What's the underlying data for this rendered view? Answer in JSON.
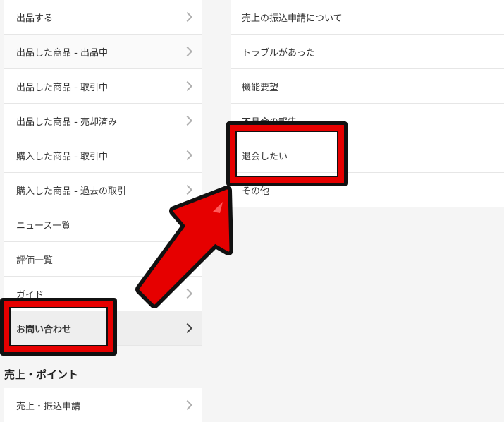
{
  "left_menu": {
    "items": [
      {
        "label": "出品する"
      },
      {
        "label": "出品した商品 - 出品中"
      },
      {
        "label": "出品した商品 - 取引中"
      },
      {
        "label": "出品した商品 - 売却済み"
      },
      {
        "label": "購入した商品 - 取引中"
      },
      {
        "label": "購入した商品 - 過去の取引"
      },
      {
        "label": "ニュース一覧"
      },
      {
        "label": "評価一覧"
      },
      {
        "label": "ガイド"
      },
      {
        "label": "お問い合わせ"
      }
    ],
    "active_label": "お問い合わせ"
  },
  "sales_section": {
    "heading": "売上・ポイント",
    "items": [
      {
        "label": "売上・振込申請"
      }
    ]
  },
  "contact_submenu": {
    "items": [
      {
        "label": "売上の振込申請について"
      },
      {
        "label": "トラブルがあった"
      },
      {
        "label": "機能要望"
      },
      {
        "label": "不具合の報告"
      },
      {
        "label": "退会したい"
      },
      {
        "label": "その他"
      }
    ],
    "highlighted_label": "退会したい"
  },
  "annotation": {
    "highlight_color": "#e60000",
    "outline_color": "#111111"
  }
}
